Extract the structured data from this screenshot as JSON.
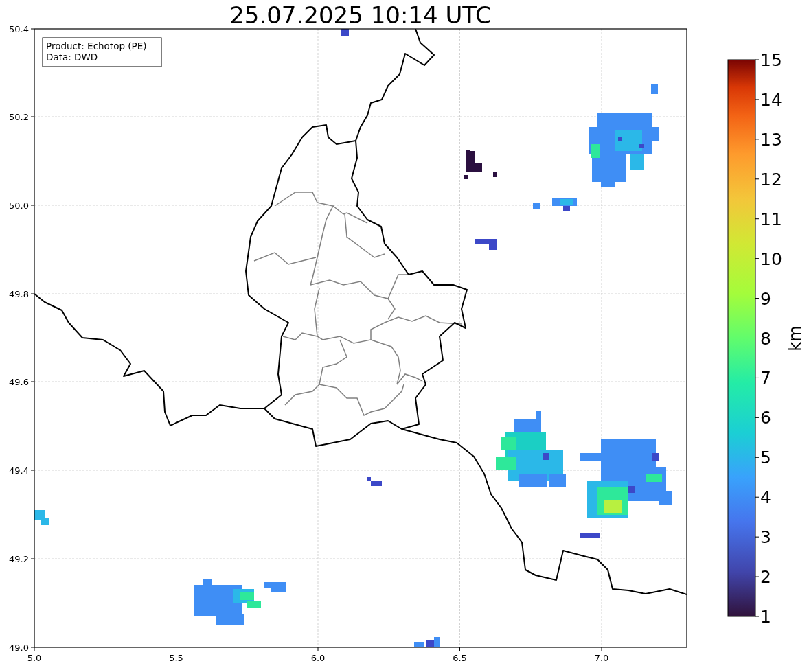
{
  "title": "25.07.2025 10:14 UTC",
  "info_box": [
    "Product: Echotop (PE)",
    "Data: DWD"
  ],
  "x_ticks": [
    "5.0",
    "5.5",
    "6.0",
    "6.5",
    "7.0"
  ],
  "y_ticks": [
    "50.4",
    "50.2",
    "50.0",
    "49.8",
    "49.6",
    "49.4",
    "49.2",
    "49.0"
  ],
  "colorbar": {
    "label": "km",
    "ticks": [
      "15",
      "14",
      "13",
      "12",
      "11",
      "10",
      "9",
      "8",
      "7",
      "6",
      "5",
      "4",
      "3",
      "2",
      "1"
    ]
  }
}
